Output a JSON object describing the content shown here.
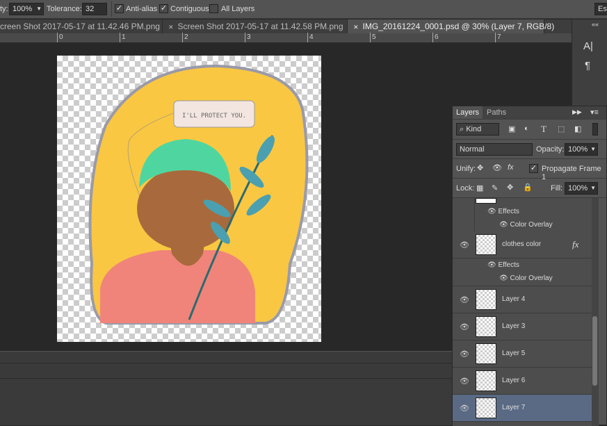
{
  "options": {
    "opacity_label": "ty:",
    "opacity_value": "100%",
    "tolerance_label": "Tolerance:",
    "tolerance_value": "32",
    "anti_alias": "Anti-alias",
    "anti_alias_checked": true,
    "contiguous": "Contiguous",
    "contiguous_checked": true,
    "all_layers": "All Layers",
    "all_layers_checked": false,
    "right_button": "Es"
  },
  "tabs": [
    {
      "label": "creen Shot 2017-05-17 at 11.42.46 PM.png",
      "active": false
    },
    {
      "label": "Screen Shot 2017-05-17 at 11.42.58 PM.png",
      "active": false
    },
    {
      "label": "IMG_20161224_0001.psd @ 30% (Layer 7, RGB/8)",
      "active": true
    }
  ],
  "ruler": [
    "0",
    "1",
    "2",
    "3",
    "4",
    "5",
    "6",
    "7"
  ],
  "artwork": {
    "speech": "I'LL PROTECT YOU."
  },
  "rightstrip": {
    "collapse": "««",
    "char_icon": "A|",
    "para_icon": "¶"
  },
  "layers_panel": {
    "tabs": [
      "Layers",
      "Paths"
    ],
    "kind": "Kind",
    "blend": "Normal",
    "opacity_label": "Opacity:",
    "opacity": "100%",
    "unify_label": "Unify:",
    "propagate": "Propagate Frame 1",
    "propagate_checked": true,
    "lock_label": "Lock:",
    "fill_label": "Fill:",
    "fill": "100%",
    "top_effects": "Effects",
    "top_overlay": "Color Overlay",
    "layers": [
      {
        "name": "clothes color",
        "fx": "fx",
        "effects": "Effects",
        "overlay": "Color Overlay"
      },
      {
        "name": "Layer 4"
      },
      {
        "name": "Layer 3"
      },
      {
        "name": "Layer 5"
      },
      {
        "name": "Layer 6"
      },
      {
        "name": "Layer 7",
        "selected": true
      }
    ]
  },
  "colors": {
    "selected_row": "#5a6a85",
    "background_yellow": "#f9c742",
    "hair": "#4fd6a0",
    "shirt": "#f0847a",
    "skin": "#a86a3c",
    "leaf": "#4aa0b0"
  }
}
